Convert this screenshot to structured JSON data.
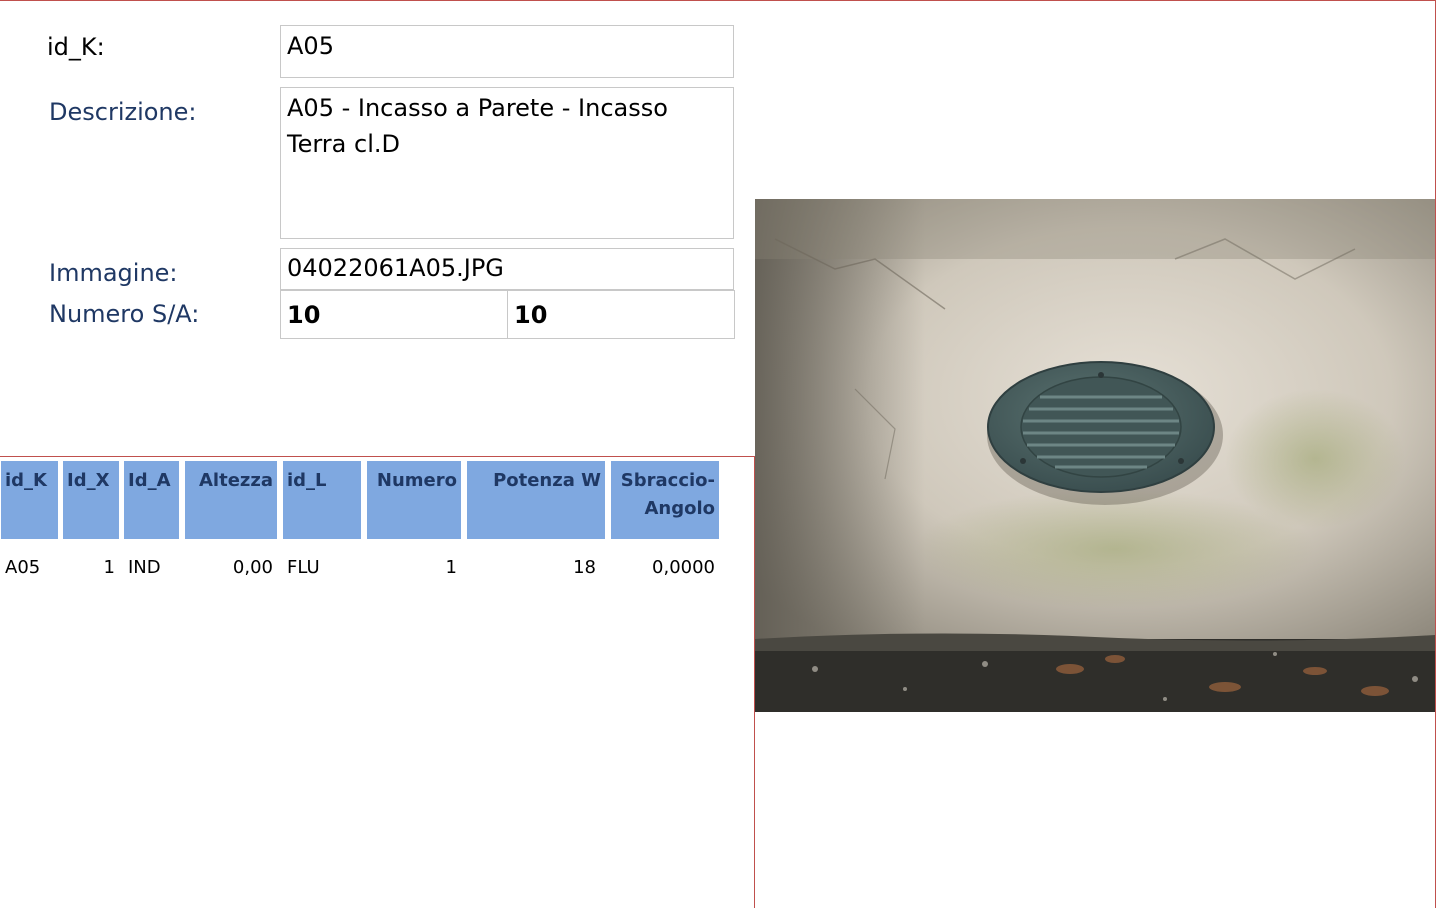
{
  "form": {
    "id_k_label": "id_K:",
    "id_k_value": "A05",
    "descrizione_label": "Descrizione:",
    "descrizione_value": "A05 - Incasso a Parete - Incasso Terra cl.D",
    "immagine_label": "Immagine:",
    "immagine_value": "04022061A05.JPG",
    "numero_label": "Numero S/A:",
    "numero_s": "10",
    "numero_a": "10"
  },
  "table": {
    "headers": [
      "id_K",
      "Id_X",
      "Id_A",
      "Altezza",
      "id_L",
      "Numero",
      "Potenza W",
      "Sbraccio-Angolo"
    ],
    "rows": [
      [
        "A05",
        "1",
        "IND",
        "0,00",
        "FLU",
        "1",
        "18",
        "0,0000"
      ]
    ]
  },
  "photo": {
    "subject": "wall-mounted round vent light fixture"
  },
  "colors": {
    "header_fill": "#7fa8e0",
    "label_text": "#1f3864",
    "border_accent": "#c0504d"
  }
}
